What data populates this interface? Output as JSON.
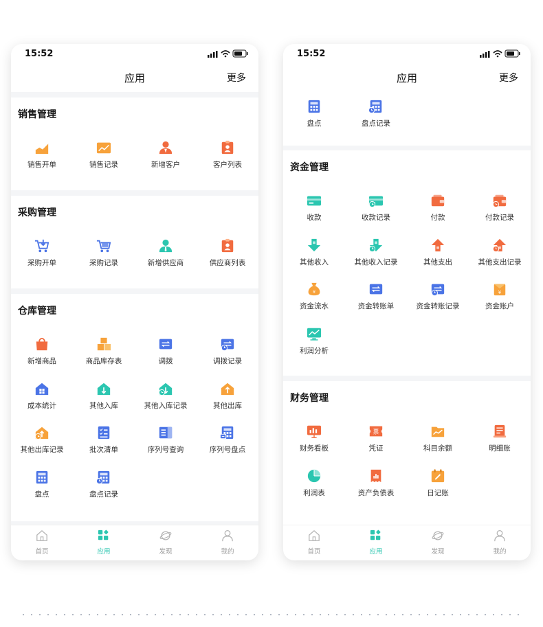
{
  "status_time": "15:52",
  "nav_title": "应用",
  "nav_more": "更多",
  "left": {
    "sections": [
      {
        "title": "销售管理",
        "items": [
          {
            "label": "销售开单",
            "icon": "chart-up-icon"
          },
          {
            "label": "销售记录",
            "icon": "trend-board-icon"
          },
          {
            "label": "新增客户",
            "icon": "person-icon"
          },
          {
            "label": "客户列表",
            "icon": "badge-person-icon"
          }
        ]
      },
      {
        "title": "采购管理",
        "items": [
          {
            "label": "采购开单",
            "icon": "cart-down-icon"
          },
          {
            "label": "采购记录",
            "icon": "cart-icon"
          },
          {
            "label": "新增供应商",
            "icon": "person-tie-icon"
          },
          {
            "label": "供应商列表",
            "icon": "badge-person-icon"
          }
        ]
      },
      {
        "title": "仓库管理",
        "items": [
          {
            "label": "新增商品",
            "icon": "shopping-bag-icon"
          },
          {
            "label": "商品库存表",
            "icon": "boxes-icon"
          },
          {
            "label": "调拨",
            "icon": "transfer-card-icon"
          },
          {
            "label": "调拨记录",
            "icon": "transfer-history-icon"
          },
          {
            "label": "成本统计",
            "icon": "house-grid-icon"
          },
          {
            "label": "其他入库",
            "icon": "house-in-icon"
          },
          {
            "label": "其他入库记录",
            "icon": "house-in-history-icon"
          },
          {
            "label": "其他出库",
            "icon": "house-out-icon"
          },
          {
            "label": "其他出库记录",
            "icon": "house-out-history-icon"
          },
          {
            "label": "批次清单",
            "icon": "checklist-icon"
          },
          {
            "label": "序列号查询",
            "icon": "book-icon"
          },
          {
            "label": "序列号盘点",
            "icon": "calculator-scan-icon"
          },
          {
            "label": "盘点",
            "icon": "calculator-icon"
          },
          {
            "label": "盘点记录",
            "icon": "calculator-history-icon"
          }
        ]
      }
    ]
  },
  "right": {
    "top_items": [
      {
        "label": "盘点",
        "icon": "calculator-icon"
      },
      {
        "label": "盘点记录",
        "icon": "calculator-history-icon"
      }
    ],
    "sections": [
      {
        "title": "资金管理",
        "items": [
          {
            "label": "收款",
            "icon": "card-icon"
          },
          {
            "label": "收款记录",
            "icon": "card-history-icon"
          },
          {
            "label": "付款",
            "icon": "wallet-icon"
          },
          {
            "label": "付款记录",
            "icon": "wallet-history-icon"
          },
          {
            "label": "其他收入",
            "icon": "arrow-down-icon"
          },
          {
            "label": "其他收入记录",
            "icon": "arrow-down-history-icon"
          },
          {
            "label": "其他支出",
            "icon": "arrow-up-icon"
          },
          {
            "label": "其他支出记录",
            "icon": "arrow-up-history-icon"
          },
          {
            "label": "资金流水",
            "icon": "money-bag-icon"
          },
          {
            "label": "资金转账单",
            "icon": "transfer-card-icon"
          },
          {
            "label": "资金转账记录",
            "icon": "transfer-history-icon"
          },
          {
            "label": "资金账户",
            "icon": "yen-envelope-icon"
          },
          {
            "label": "利润分析",
            "icon": "monitor-chart-icon"
          }
        ]
      },
      {
        "title": "财务管理",
        "items": [
          {
            "label": "财务看板",
            "icon": "board-icon"
          },
          {
            "label": "凭证",
            "icon": "ticket-icon"
          },
          {
            "label": "科目余额",
            "icon": "folder-chart-icon"
          },
          {
            "label": "明细账",
            "icon": "ledger-icon"
          },
          {
            "label": "利润表",
            "icon": "pie-icon"
          },
          {
            "label": "资产负债表",
            "icon": "receipt-icon"
          },
          {
            "label": "日记账",
            "icon": "calendar-icon"
          }
        ]
      }
    ]
  },
  "tabs": [
    {
      "label": "首页",
      "icon": "home-icon",
      "active": false
    },
    {
      "label": "应用",
      "icon": "apps-icon",
      "active": true
    },
    {
      "label": "发现",
      "icon": "planet-icon",
      "active": false
    },
    {
      "label": "我的",
      "icon": "user-icon",
      "active": false
    }
  ],
  "colors": {
    "accent": "#2bc6b0",
    "orange": "#f7a23b",
    "red_orange": "#f16b3f",
    "blue": "#4b74e6",
    "teal": "#2bc6b0",
    "background": "#f4f5f7",
    "tab_inactive": "#9a9a9a"
  }
}
